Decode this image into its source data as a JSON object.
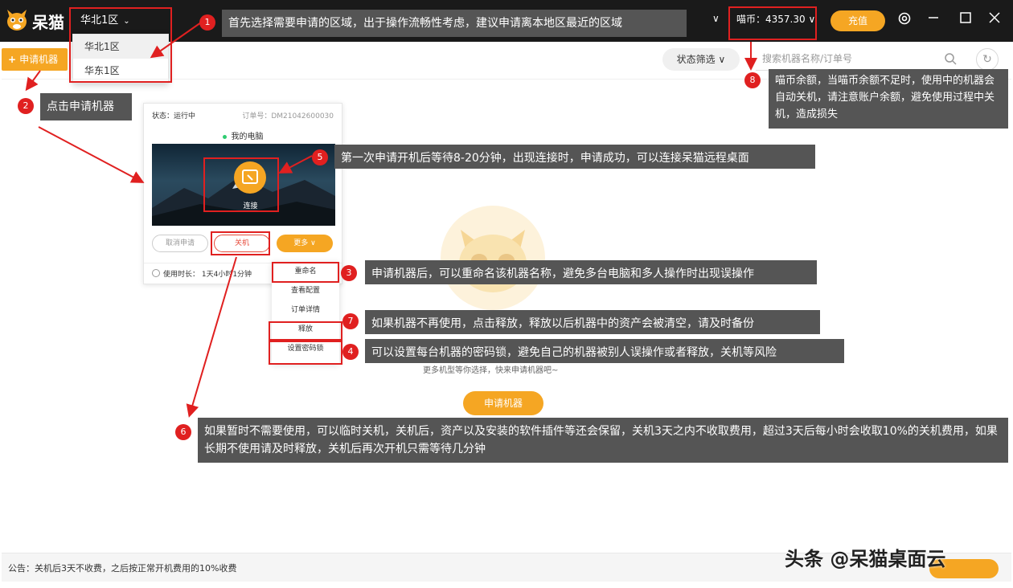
{
  "app": {
    "name": "呆猫",
    "region": "华北1区",
    "balance": "喵币：4357.30",
    "recharge": "充值"
  },
  "region_dropdown": {
    "options": [
      "华北1区",
      "华东1区"
    ]
  },
  "toolbar": {
    "apply": "申请机器",
    "status_filter": "状态筛选",
    "search_placeholder": "搜索机器名称/订单号"
  },
  "card": {
    "status": "状态：运行中",
    "order": "订单号：DM21042600030",
    "name": "我的电脑",
    "connect": "连接",
    "cancel": "取消申请",
    "shutdown": "关机",
    "more": "更多",
    "usage": "使用时长：  1天4小时1分钟"
  },
  "more_menu": {
    "items": [
      "重命名",
      "查看配置",
      "订单详情",
      "释放",
      "设置密码锁"
    ]
  },
  "empty": {
    "text": "更多机型等你选择，快来申请机器吧~",
    "apply": "申请机器"
  },
  "notice": "公告：关机后3天不收费，之后按正常开机费用的10%收费",
  "watermark": "头条 @呆猫桌面云",
  "annotations": [
    {
      "n": "1",
      "text": "首先选择需要申请的区域，出于操作流畅性考虑，建议申请离本地区最近的区域"
    },
    {
      "n": "2",
      "text": "点击申请机器"
    },
    {
      "n": "3",
      "text": "申请机器后，可以重命名该机器名称，避免多台电脑和多人操作时出现误操作"
    },
    {
      "n": "4",
      "text": "可以设置每台机器的密码锁，避免自己的机器被别人误操作或者释放，关机等风险"
    },
    {
      "n": "5",
      "text": "第一次申请开机后等待8-20分钟，出现连接时，申请成功，可以连接呆猫远程桌面"
    },
    {
      "n": "6",
      "text": "如果暂时不需要使用，可以临时关机，关机后，资产以及安装的软件插件等还会保留，关机3天之内不收取费用，超过3天后每小时会收取10%的关机费用，如果长期不使用请及时释放，关机后再次开机只需等待几分钟"
    },
    {
      "n": "7",
      "text": "如果机器不再使用，点击释放，释放以后机器中的资产会被清空，请及时备份"
    },
    {
      "n": "8",
      "text": "喵币余额，当喵币余额不足时，使用中的机器会自动关机，请注意账户余额，避免使用过程中关机，造成损失"
    }
  ],
  "colors": {
    "accent": "#f5a623",
    "titlebar": "#1a1a1a",
    "annotation": "#e02020",
    "note_bg": "#555555"
  }
}
